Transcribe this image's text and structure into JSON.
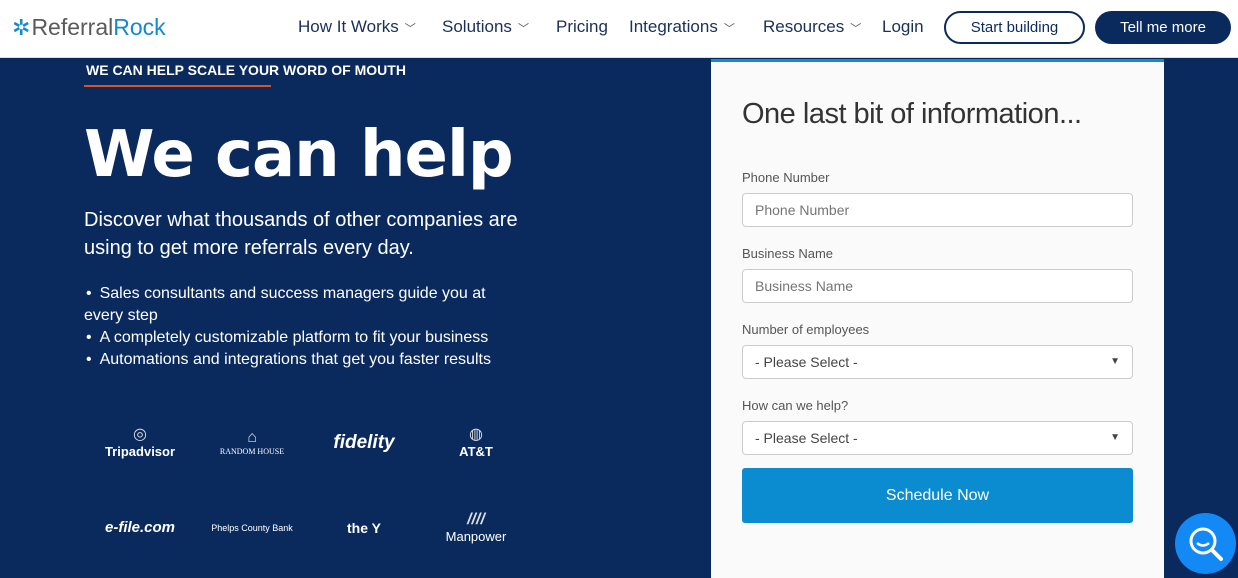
{
  "header": {
    "logo_part1": "Referral",
    "logo_part2": "Rock",
    "nav": [
      {
        "label": "How It Works",
        "dropdown": true
      },
      {
        "label": "Solutions",
        "dropdown": true
      },
      {
        "label": "Pricing",
        "dropdown": false
      },
      {
        "label": "Integrations",
        "dropdown": true
      },
      {
        "label": "Resources",
        "dropdown": true
      },
      {
        "label": "Login",
        "dropdown": false
      }
    ],
    "start_building": "Start building",
    "tell_me_more": "Tell me more"
  },
  "hero": {
    "eyebrow": "WE CAN HELP SCALE YOUR WORD OF MOUTH",
    "title": "We can help",
    "subtitle": "Discover what thousands of other companies are using to get more referrals every day.",
    "bullets": [
      "Sales consultants and success managers guide you at every step",
      "A completely customizable platform to fit your business",
      "Automations and integrations that get you faster results"
    ],
    "logos": [
      "Tripadvisor",
      "RANDOM HOUSE",
      "fidelity",
      "AT&T",
      "e-file.com",
      "Phelps County Bank",
      "the Y",
      "Manpower"
    ]
  },
  "form": {
    "title": "One last bit of information...",
    "phone_label": "Phone Number",
    "phone_placeholder": "Phone Number",
    "business_label": "Business Name",
    "business_placeholder": "Business Name",
    "employees_label": "Number of employees",
    "employees_value": "- Please Select -",
    "help_label": "How can we help?",
    "help_value": "- Please Select -",
    "submit": "Schedule Now"
  },
  "colors": {
    "navy": "#0a2a5e",
    "accent": "#1389cf",
    "eyebrow_underline": "#d9541e"
  }
}
